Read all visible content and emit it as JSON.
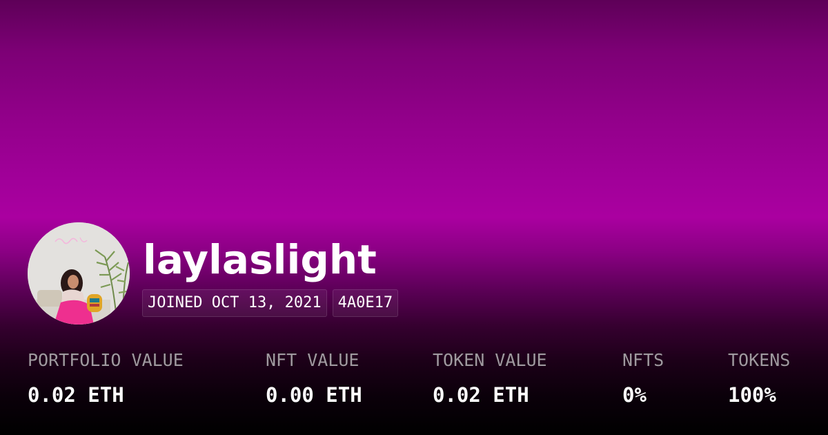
{
  "profile": {
    "username": "laylaslight",
    "joined": "JOINED OCT 13, 2021",
    "address_short": "4A0E17"
  },
  "stats": [
    {
      "label": "PORTFOLIO VALUE",
      "value": "0.02 ETH"
    },
    {
      "label": "NFT VALUE",
      "value": "0.00 ETH"
    },
    {
      "label": "TOKEN VALUE",
      "value": "0.02 ETH"
    },
    {
      "label": "NFTS",
      "value": "0%"
    },
    {
      "label": "TOKENS",
      "value": "100%"
    }
  ],
  "colors": {
    "background_top": "#5e0058",
    "background_mid": "#aa00a0",
    "background_bottom": "#000000",
    "label": "#9f9a9f",
    "text": "#ffffff"
  }
}
